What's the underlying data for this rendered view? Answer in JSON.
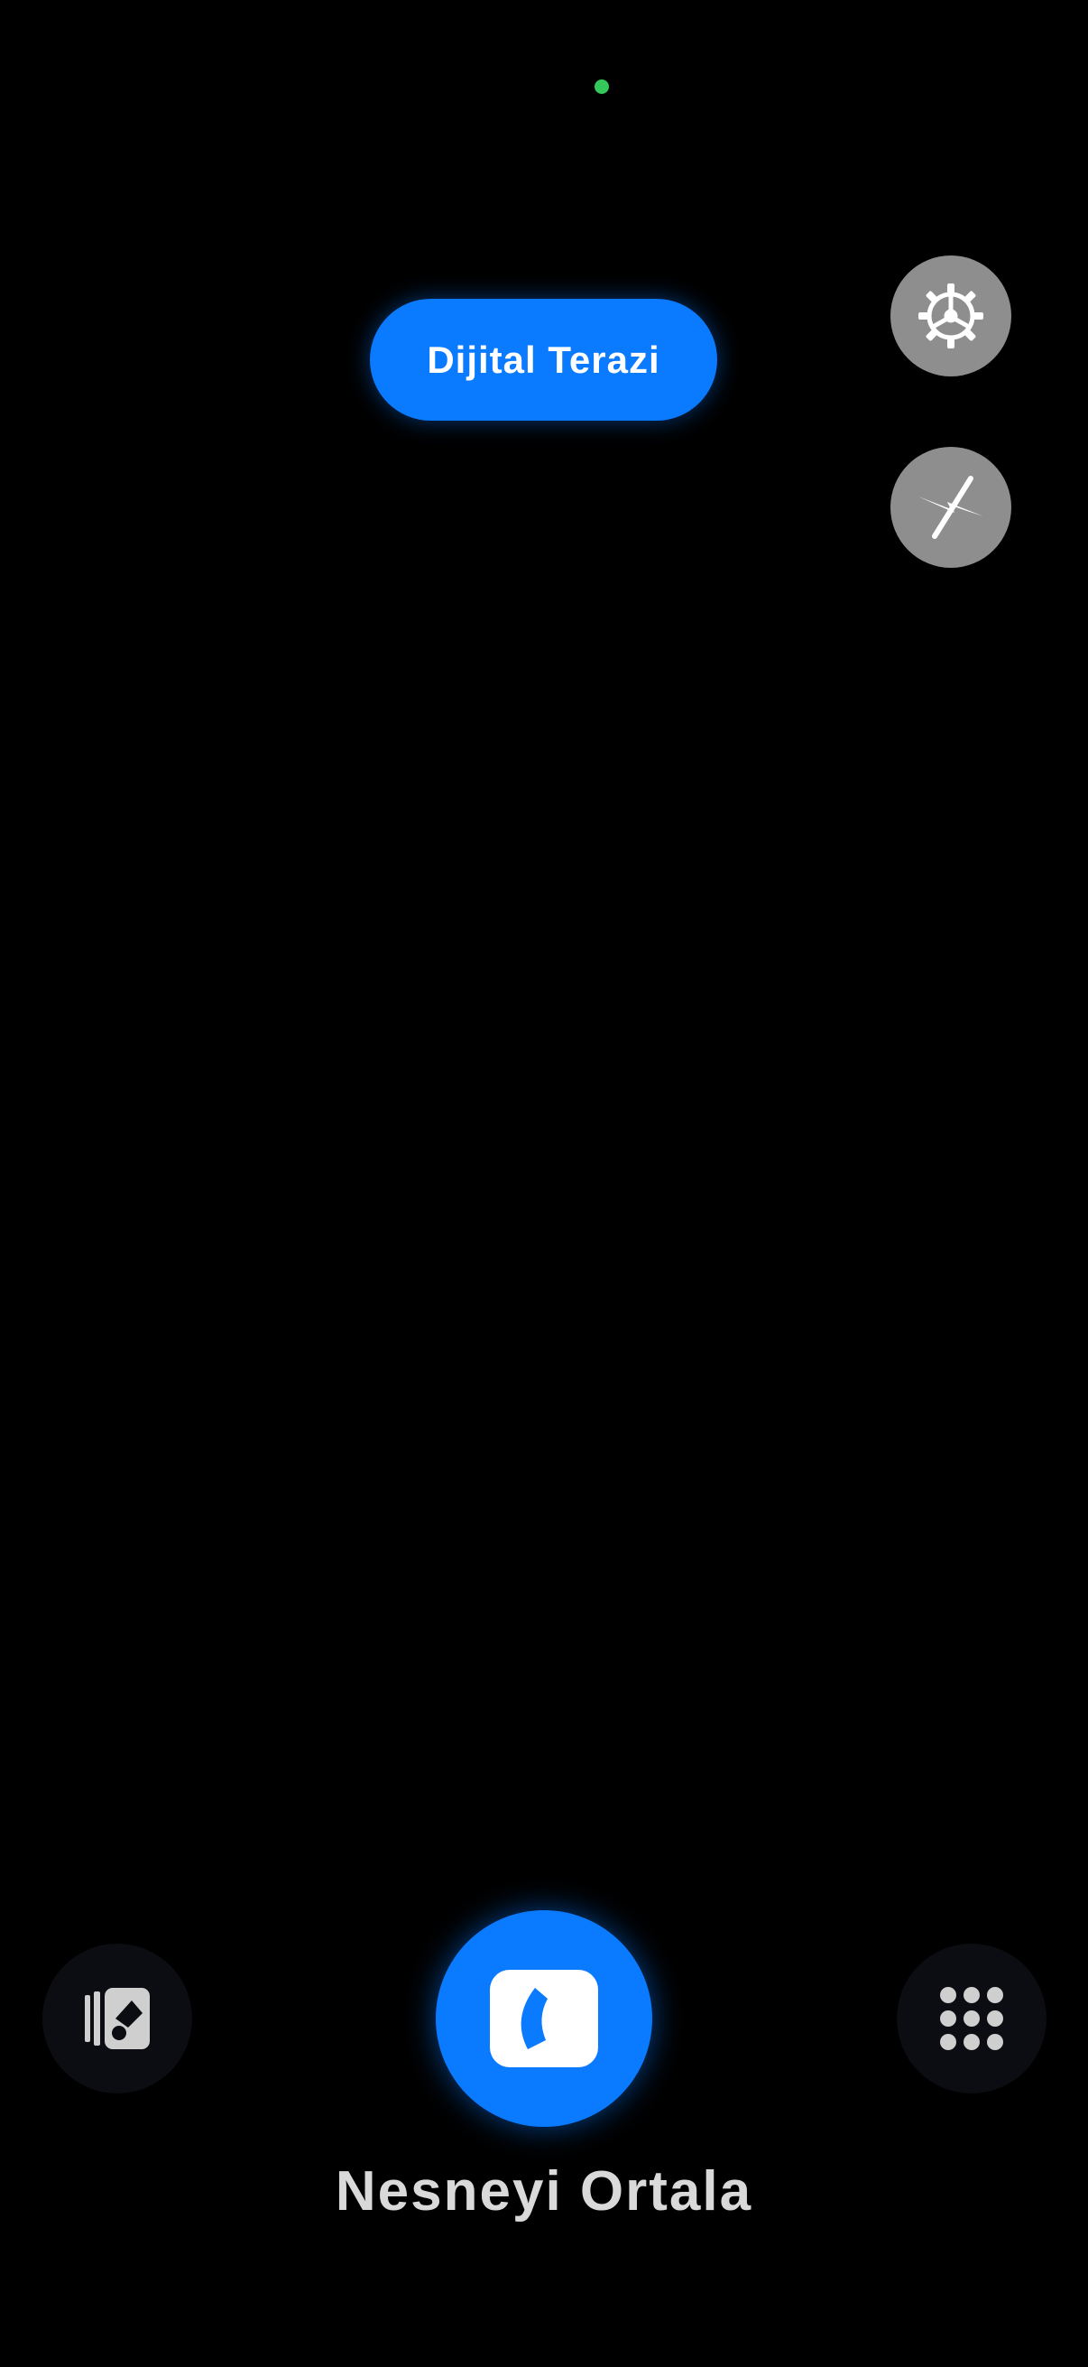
{
  "status": {
    "privacy_indicator_color": "#34c759"
  },
  "mode": {
    "label": "Dijital Terazi",
    "color": "#0a7aff"
  },
  "controls": {
    "settings_icon": "gear-icon",
    "flash_icon": "flash-off-icon"
  },
  "bottom_bar": {
    "gallery_icon": "gallery-icon",
    "shutter_icon": "scale-capture-icon",
    "menu_icon": "grid-menu-icon",
    "hint": "Nesneyi Ortala"
  }
}
